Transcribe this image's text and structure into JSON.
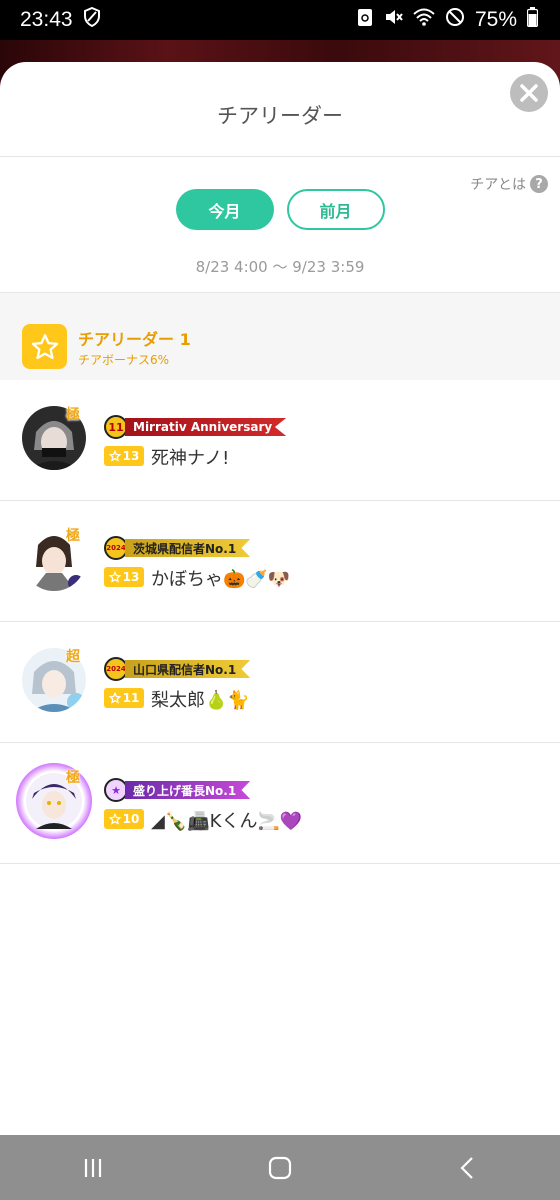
{
  "status_bar": {
    "time": "23:43",
    "battery": "75%"
  },
  "sheet": {
    "title": "チアリーダー",
    "help_label": "チアとは",
    "tabs": [
      {
        "label": "今月",
        "active": true
      },
      {
        "label": "前月",
        "active": false
      }
    ],
    "period": "8/23 4:00 ～ 9/23 3:59",
    "rank": {
      "title": "チアリーダー 1",
      "bonus": "チアボーナス6%"
    },
    "users": [
      {
        "grade": "極",
        "banner_text": "Mirrativ Anniversary",
        "medal": "11",
        "level": "13",
        "name": "死神ナノ!"
      },
      {
        "grade": "極",
        "banner_text": "茨城県配信者No.1",
        "medal": "2024",
        "level": "13",
        "name": "かぼちゃ🎃🍼🐶"
      },
      {
        "grade": "超",
        "banner_text": "山口県配信者No.1",
        "medal": "2024",
        "level": "11",
        "name": "梨太郎🍐🐈"
      },
      {
        "grade": "極",
        "banner_text": "盛り上げ番長No.1",
        "medal": "★",
        "level": "10",
        "name": "◢🍾📠Kくん🚬💜"
      }
    ]
  },
  "colors": {
    "accent": "#2ec7a0",
    "gold": "#ffc71a",
    "rank_text": "#e99d00"
  }
}
